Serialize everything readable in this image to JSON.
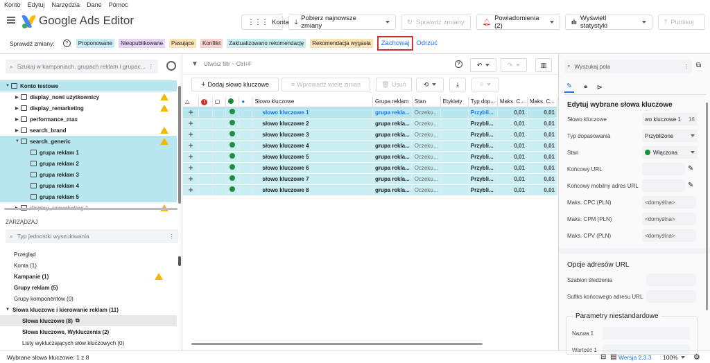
{
  "menu": [
    "Konto",
    "Edytuj",
    "Narzędzia",
    "Dane",
    "Pomoc"
  ],
  "app_title": "Google Ads Editor",
  "header_buttons": {
    "accounts": "Konta",
    "get_changes": "Pobierz najnowsze zmiany",
    "check_changes": "Sprawdź zmiany",
    "notifications": "Powiadomienia (2)",
    "stats": "Wyświetl statystyki",
    "publish": "Publikuj"
  },
  "review": {
    "label": "Sprawdź zmiany:",
    "chips": [
      {
        "text": "Proponowane",
        "bg": "#c8ecf4"
      },
      {
        "text": "Nieopublikowane",
        "bg": "#e7d3f5"
      },
      {
        "text": "Pasujące",
        "bg": "#fbe3b6"
      },
      {
        "text": "Konflikt",
        "bg": "#f8d4cf"
      },
      {
        "text": "Zaktualizowano rekomendację",
        "bg": "#cdeef1"
      },
      {
        "text": "Rekomendacja wygasła",
        "bg": "#fbe3b6"
      }
    ],
    "keep": "Zachowaj",
    "discard": "Odrzuć"
  },
  "left": {
    "search_placeholder": "Szukaj w kampaniach, grupach reklam i grupac...",
    "tree": [
      {
        "label": "Konto testowe",
        "level": 0,
        "selected": true,
        "warn": false
      },
      {
        "label": "display_nowi użytkownicy",
        "level": 1,
        "selected": false,
        "warn": true
      },
      {
        "label": "display_remarketing",
        "level": 1,
        "selected": false,
        "warn": true
      },
      {
        "label": "performance_max",
        "level": 1,
        "selected": false,
        "warn": false
      },
      {
        "label": "search_brand",
        "level": 1,
        "selected": false,
        "warn": true
      },
      {
        "label": "search_generic",
        "level": 1,
        "selected": true,
        "warn": true
      },
      {
        "label": "grupa reklam 1",
        "level": 2,
        "selected": true,
        "warn": false
      },
      {
        "label": "grupa reklam 2",
        "level": 2,
        "selected": true,
        "warn": false
      },
      {
        "label": "grupa reklam 3",
        "level": 2,
        "selected": true,
        "warn": false
      },
      {
        "label": "grupa reklam 4",
        "level": 2,
        "selected": true,
        "warn": false
      },
      {
        "label": "grupa reklam 5",
        "level": 2,
        "selected": true,
        "warn": false
      },
      {
        "label": "display_remarketing 1",
        "level": 1,
        "selected": false,
        "warn": true
      }
    ],
    "manage_label": "ZARZĄDZAJ",
    "manage_search_placeholder": "Typ jednostki wyszukiwania",
    "manage_items": [
      {
        "label": "Przegląd",
        "bold": false
      },
      {
        "label": "Konta (1)",
        "bold": false
      },
      {
        "label": "Kampanie (1)",
        "bold": true
      },
      {
        "label": "Grupy reklam (5)",
        "bold": true
      },
      {
        "label": "Grupy komponentów (0)",
        "bold": false
      },
      {
        "label": "Słowa kluczowe i kierowanie reklam (11)",
        "bold": true
      },
      {
        "label": "Słowa kluczowe (8)",
        "bold": true
      },
      {
        "label": "Słowa kluczowe, Wykluczenia (2)",
        "bold": true
      },
      {
        "label": "Listy wykluczających słów kluczowych (0)",
        "bold": false
      }
    ]
  },
  "center": {
    "filter_placeholder": "Utwórz filtr ~ Ctrl+F",
    "add_keyword": "Dodaj słowo kluczowe",
    "bulk_changes": "Wprowadź wiele zmian",
    "delete": "Usuń",
    "columns": [
      "Słowo kluczowe",
      "Grupa reklam",
      "Stan",
      "Etykiety",
      "Typ dop...",
      "Maks. C...",
      "Maks. C..."
    ],
    "rows": [
      {
        "keyword": "słowo kluczowe 1",
        "group": "grupa rekla...",
        "status": "Oczeku...",
        "labels": "",
        "match": "Przybli...",
        "cpc": "0,01",
        "cpm": "0,01"
      },
      {
        "keyword": "słowo kluczowe 2",
        "group": "grupa rekla...",
        "status": "Oczeku...",
        "labels": "",
        "match": "Przybli...",
        "cpc": "0,01",
        "cpm": "0,01"
      },
      {
        "keyword": "słowo kluczowe 3",
        "group": "grupa rekla...",
        "status": "Oczeku...",
        "labels": "",
        "match": "Przybli...",
        "cpc": "0,01",
        "cpm": "0,01"
      },
      {
        "keyword": "słowo kluczowe 4",
        "group": "grupa rekla...",
        "status": "Oczeku...",
        "labels": "",
        "match": "Przybli...",
        "cpc": "0,01",
        "cpm": "0,01"
      },
      {
        "keyword": "słowo kluczowe 5",
        "group": "grupa rekla...",
        "status": "Oczeku...",
        "labels": "",
        "match": "Przybli...",
        "cpc": "0,01",
        "cpm": "0,01"
      },
      {
        "keyword": "słowo kluczowe 6",
        "group": "grupa rekla...",
        "status": "Oczeku...",
        "labels": "",
        "match": "Przybli...",
        "cpc": "0,01",
        "cpm": "0,01"
      },
      {
        "keyword": "słowo kluczowe 7",
        "group": "grupa rekla...",
        "status": "Oczeku...",
        "labels": "",
        "match": "Przybli...",
        "cpc": "0,01",
        "cpm": "0,01"
      },
      {
        "keyword": "słowo kluczowe 8",
        "group": "grupa rekla...",
        "status": "Oczeku...",
        "labels": "",
        "match": "Przybli...",
        "cpc": "0,01",
        "cpm": "0,01"
      }
    ]
  },
  "right": {
    "search_placeholder": "Wyszukaj pola",
    "section_title": "Edytuj wybrane słowa kluczowe",
    "keyword_label": "Słowo kluczowe",
    "keyword_value": "wo kluczowe 1",
    "keyword_count": "16",
    "match_label": "Typ dopasowania",
    "match_value": "Przybliżone",
    "status_label": "Stan",
    "status_value": "Włączona",
    "final_url_label": "Końcowy URL",
    "mobile_url_label": "Końcowy mobilny adres URL",
    "cpc_label": "Maks. CPC (PLN)",
    "cpc_value": "<domyślna>",
    "cpm_label": "Maks. CPM (PLN)",
    "cpm_value": "<domyślna>",
    "cpv_label": "Maks. CPV (PLN)",
    "cpv_value": "<domyślna>",
    "url_options_title": "Opcje adresów URL",
    "tracking_label": "Szablon śledzenia",
    "suffix_label": "Sufiks końcowego adresu URL",
    "custom_params_title": "Parametry niestandardowe",
    "name1_label": "Nazwa 1",
    "value1_label": "Wartość 1"
  },
  "footer": {
    "selection": "Wybrane słowa kluczowe: 1 z 8",
    "version": "Wersja 2.3.3",
    "zoom": "100%"
  }
}
